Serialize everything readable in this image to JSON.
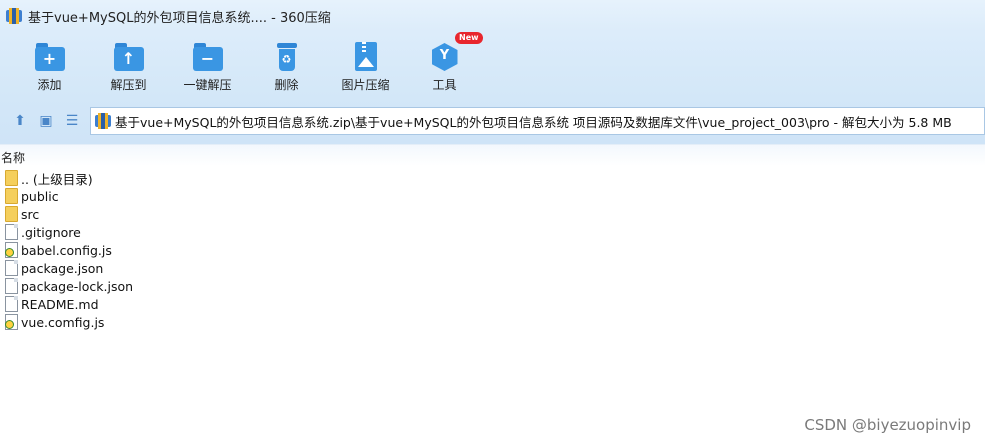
{
  "window": {
    "title": "基于vue+MySQL的外包项目信息系统.... - 360压缩"
  },
  "toolbar": {
    "add_label": "添加",
    "extract_to_label": "解压到",
    "one_click_extract_label": "一键解压",
    "delete_label": "删除",
    "image_compress_label": "图片压缩",
    "tools_label": "工具",
    "tools_badge": "New"
  },
  "address": {
    "path": "基于vue+MySQL的外包项目信息系统.zip\\基于vue+MySQL的外包项目信息系统 项目源码及数据库文件\\vue_project_003\\pro - 解包大小为 5.8 MB"
  },
  "list": {
    "column_name": "名称",
    "items": [
      {
        "name": ".. (上级目录)",
        "type": "folder"
      },
      {
        "name": "public",
        "type": "folder"
      },
      {
        "name": "src",
        "type": "folder"
      },
      {
        "name": ".gitignore",
        "type": "file"
      },
      {
        "name": "babel.config.js",
        "type": "js"
      },
      {
        "name": "package.json",
        "type": "file"
      },
      {
        "name": "package-lock.json",
        "type": "file"
      },
      {
        "name": "README.md",
        "type": "file"
      },
      {
        "name": "vue.comfig.js",
        "type": "js"
      }
    ]
  },
  "watermark": "CSDN @biyezuopinvip",
  "icons": {
    "up": "arrow-up-icon",
    "view": "thumbnail-view-icon",
    "list": "list-view-icon"
  },
  "colors": {
    "accent": "#3a96e3",
    "badge": "#e8262d",
    "folder": "#f5cf5c"
  }
}
